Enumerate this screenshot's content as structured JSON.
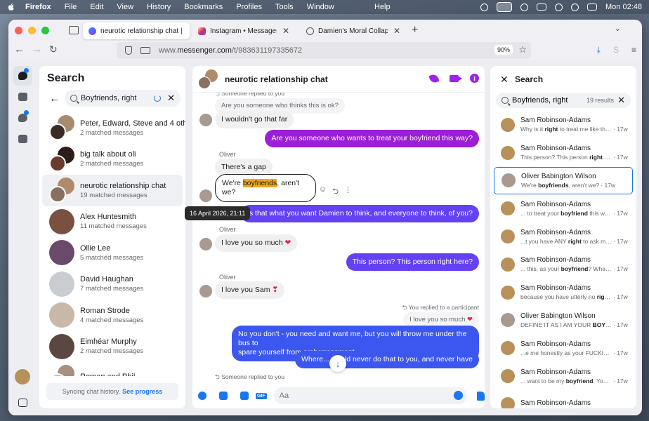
{
  "menubar": {
    "app": "Firefox",
    "items": [
      "File",
      "Edit",
      "View",
      "History",
      "Bookmarks",
      "Profiles",
      "Tools",
      "Window"
    ],
    "help": "Help",
    "clock": "Mon 02:48"
  },
  "tabs": [
    {
      "title": "neurotic relationship chat | Mes",
      "icon": "messenger-icon",
      "active": true
    },
    {
      "title": "Instagram • Messages",
      "icon": "instagram-icon",
      "active": false
    },
    {
      "title": "Damien's Moral Collapse",
      "icon": "globe-icon",
      "active": false
    }
  ],
  "address": {
    "domain_prefix": "www.",
    "domain": "messenger.com",
    "path": "/t/983631197335672",
    "zoom": "90%"
  },
  "left_panel": {
    "title": "Search",
    "search_value": "Boyfriends, right",
    "conversations": [
      {
        "name": "Peter, Edward, Steve and 4 others",
        "sub": "2 matched messages",
        "group": true,
        "c1": "#a88a70",
        "c2": "#3a2a24"
      },
      {
        "name": "big talk about oli",
        "sub": "2 matched messages",
        "group": true,
        "c1": "#2b1d18",
        "c2": "#6b3a2c"
      },
      {
        "name": "neurotic relationship chat",
        "sub": "19 matched messages",
        "group": true,
        "active": true,
        "c1": "#b08a6a",
        "c2": "#8a7060"
      },
      {
        "name": "Alex Huntesmith",
        "sub": "11 matched messages",
        "group": false,
        "c1": "#7a5040"
      },
      {
        "name": "Ollie Lee",
        "sub": "5 matched messages",
        "group": false,
        "c1": "#6a4a6a"
      },
      {
        "name": "David Haughan",
        "sub": "7 matched messages",
        "group": false,
        "c1": "#c9ccd1"
      },
      {
        "name": "Roman Strode",
        "sub": "4 matched messages",
        "group": false,
        "c1": "#c8b8a8"
      },
      {
        "name": "Eimhéar Murphy",
        "sub": "2 matched messages",
        "group": false,
        "c1": "#5a4840"
      },
      {
        "name": "Roman and Phil",
        "sub": "",
        "group": true,
        "c1": "#a89080",
        "c2": "#d0c0b0"
      }
    ],
    "tooltip": "16 April 2026, 21:11",
    "sync_text": "Syncing chat history.",
    "sync_link": "See progress"
  },
  "chat": {
    "title": "neurotic relationship chat",
    "messages": {
      "reply_note_1": "Someone replied to you",
      "reply_quote_1": "Are you someone who thinks this is ok?",
      "in_1": "I wouldn't go that far",
      "out_1": "Are you someone who wants to treat your boyfriend this way?",
      "sender_1": "Oliver",
      "in_2": "There's a gap",
      "focus_pre": "We're ",
      "focus_hl": "boyfriends",
      "focus_post": ", aren't",
      "focus_line2": "we?",
      "out_2": "Is that what you want Damien to think, and everyone to think, of you?",
      "sender_2": "Oliver",
      "in_3": "I love you so much",
      "out_3": "This person? This person right here?",
      "sender_3": "Oliver",
      "in_4": "I love you Sam",
      "reply_note_2": "You replied to a participant",
      "reply_quote_2": "I love you so much",
      "out_4_line1": "No you don't - you need and want me, but you will throw me under the bus to",
      "out_4_line2": "spare yourself from embarrassment",
      "out_5": "Where... would never do that to you, and never have",
      "reply_note_3": "Someone replied to you"
    },
    "composer_placeholder": "Aa"
  },
  "right_panel": {
    "title": "Search",
    "search_value": "Boyfriends, right",
    "results_count": "19 results",
    "results": [
      {
        "name": "Sam Robinson-Adams",
        "pre": "Why is it ",
        "hl": "right",
        "post": " to treat me like this?",
        "time": "· 17w",
        "color": "#b8905a"
      },
      {
        "name": "Sam Robinson-Adams",
        "pre": "This person? This person ",
        "hl": "right",
        "post": " he...",
        "time": "· 17w",
        "color": "#b8905a"
      },
      {
        "name": "Oliver Babington Wilson",
        "pre": "We're ",
        "hl": "boyfriends",
        "post": ", aren't we?",
        "time": "· 17w",
        "color": "#a89a90",
        "active": true
      },
      {
        "name": "Sam Robinson-Adams",
        "pre": "... to treat your ",
        "hl": "boyfriend",
        "post": " this way?",
        "time": "· 17w",
        "color": "#b8905a"
      },
      {
        "name": "Sam Robinson-Adams",
        "pre": "...t you have ANY ",
        "hl": "right",
        "post": " to ask me ...",
        "time": "· 17w",
        "color": "#b8905a"
      },
      {
        "name": "Sam Robinson-Adams",
        "pre": "... this, as your ",
        "hl": "boyfriend",
        "post": "? What i...",
        "time": "· 17w",
        "color": "#b8905a"
      },
      {
        "name": "Sam Robinson-Adams",
        "pre": "because you have utterly no ",
        "hl": "right",
        "post": "...",
        "time": "· 17w",
        "color": "#b8905a"
      },
      {
        "name": "Oliver Babington Wilson",
        "pre": "DEFINE IT AS I AM YOUR ",
        "hl": "BOYFRI",
        "post": "...",
        "time": "· 17w",
        "color": "#a89a90"
      },
      {
        "name": "Sam Robinson-Adams",
        "pre": "...e me honestly as your FUCKING ",
        "hl": "",
        "post": "",
        "time": "· 17w",
        "color": "#b8905a"
      },
      {
        "name": "Sam Robinson-Adams",
        "pre": "... want to be my ",
        "hl": "boyfriend",
        "post": ". You ...",
        "time": "· 17w",
        "color": "#b8905a"
      },
      {
        "name": "Sam Robinson-Adams",
        "pre": "",
        "hl": "",
        "post": "",
        "time": "",
        "color": "#b8905a"
      }
    ]
  },
  "colors": {
    "accent": "#1877f2",
    "purple": "#9b1ed8",
    "violet": "#6540f5",
    "blue": "#3b57f0",
    "highlight": "#f0a818"
  }
}
